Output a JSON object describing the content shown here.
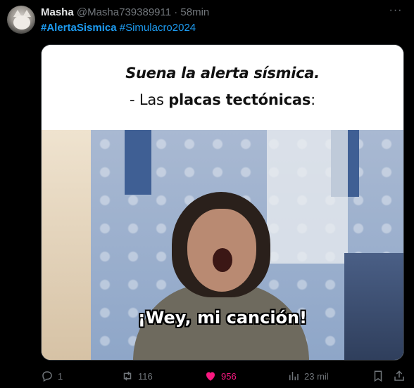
{
  "tweet": {
    "author_name": "Masha",
    "handle": "@Masha739389911",
    "separator": "·",
    "time": "58min",
    "more_label": "···",
    "hashtags": [
      "#AlertaSismica",
      "#Simulacro2024"
    ]
  },
  "media": {
    "caption_line1": "Suena la alerta sísmica.",
    "caption_line2_prefix": "-  Las ",
    "caption_line2_bold": "placas tectónicas",
    "caption_line2_suffix": ":",
    "subtitle": "¡Wey, mi canción!"
  },
  "actions": {
    "replies": "1",
    "retweets": "116",
    "likes": "956",
    "views": "23 mil"
  },
  "colors": {
    "background": "#000000",
    "text": "#e7e9ea",
    "muted": "#71767b",
    "link": "#1d9bf0",
    "like": "#f91880"
  },
  "icons": {
    "reply": "reply-icon",
    "retweet": "retweet-icon",
    "like": "heart-icon",
    "views": "views-icon",
    "bookmark": "bookmark-icon",
    "share": "share-icon",
    "more": "more-icon"
  }
}
